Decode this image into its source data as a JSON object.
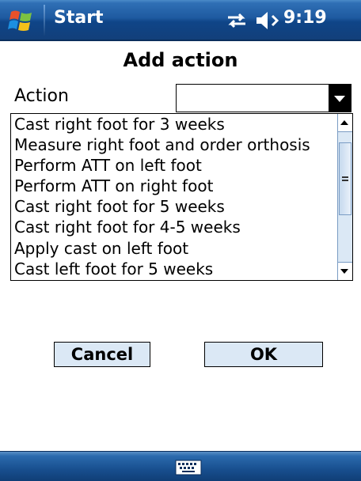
{
  "titlebar": {
    "start_label": "Start",
    "clock": "9:19",
    "icons": [
      "windows-flag-icon",
      "connectivity-icon",
      "volume-icon"
    ]
  },
  "dialog": {
    "heading": "Add action",
    "action_label": "Action",
    "action_value": ""
  },
  "list": {
    "items": [
      "Cast right foot for 3 weeks",
      "Measure right foot and order orthosis",
      "Perform ATT on left foot",
      "Perform ATT on right foot",
      "Cast right foot for 5 weeks",
      "Cast right foot for 4-5 weeks",
      "Apply cast on left foot",
      "Cast left foot for 5 weeks"
    ]
  },
  "buttons": {
    "cancel": "Cancel",
    "ok": "OK"
  },
  "menubar": {
    "icons": [
      "keyboard-icon"
    ]
  },
  "colors": {
    "titlebar": "#1e5aa0",
    "button_face": "#dbe8f5",
    "scrollbar": "#dbe8f5"
  }
}
